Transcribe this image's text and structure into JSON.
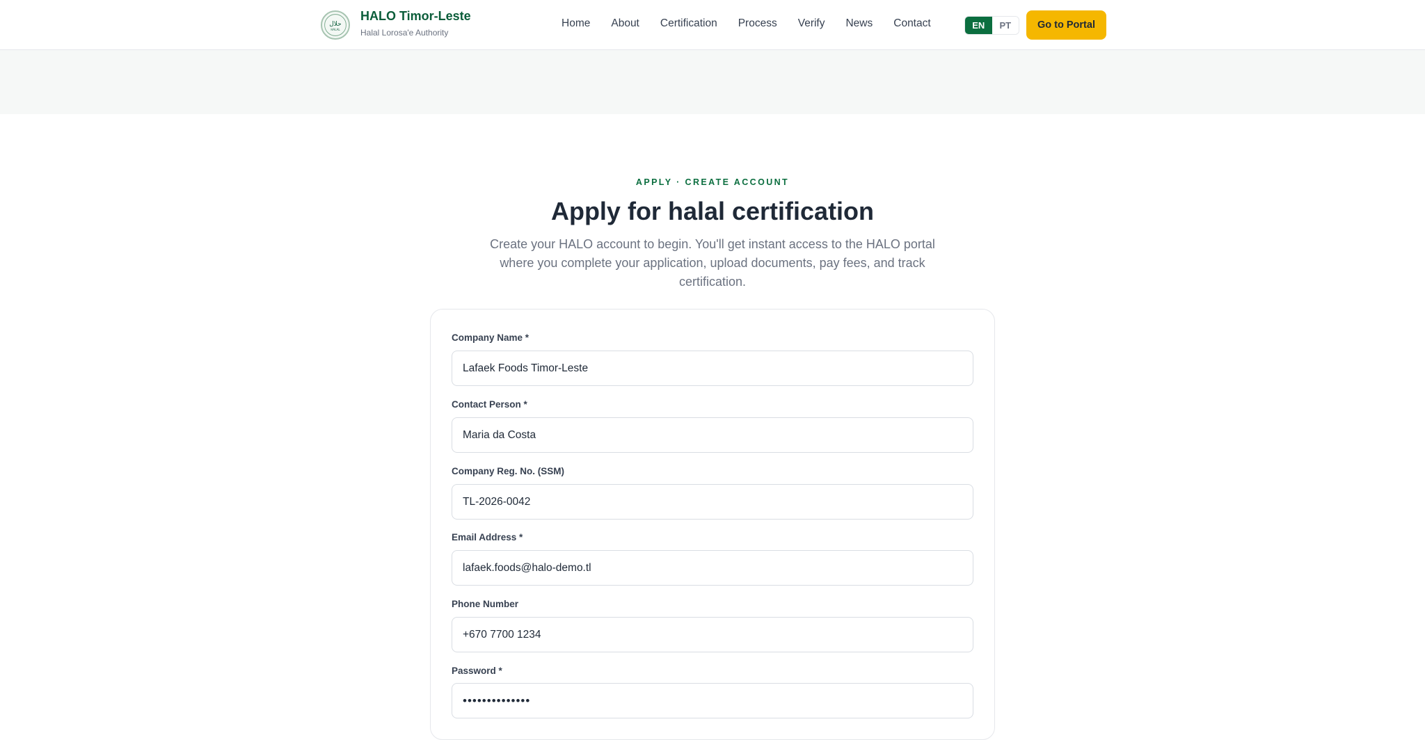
{
  "brand": {
    "title": "HALO Timor-Leste",
    "subtitle": "Halal Lorosa'e Authority",
    "logo_icon": "halal-seal-icon",
    "logo_text": "حلال",
    "logo_sub": "HALAL"
  },
  "nav": {
    "items": [
      {
        "label": "Home"
      },
      {
        "label": "About"
      },
      {
        "label": "Certification"
      },
      {
        "label": "Process"
      },
      {
        "label": "Verify"
      },
      {
        "label": "News"
      },
      {
        "label": "Contact"
      }
    ]
  },
  "lang": {
    "en": "EN",
    "pt": "PT",
    "selected": "EN"
  },
  "header": {
    "portal_button": "Go to Portal"
  },
  "intro": {
    "eyebrow": "APPLY · CREATE ACCOUNT",
    "title": "Apply for halal certification",
    "lead": "Create your HALO account to begin. You'll get instant access to the HALO portal where you complete your application, upload documents, pay fees, and track certification."
  },
  "form": {
    "company_name": {
      "label": "Company Name *",
      "value": "Lafaek Foods Timor-Leste"
    },
    "contact_person": {
      "label": "Contact Person *",
      "value": "Maria da Costa"
    },
    "reg_no": {
      "label": "Company Reg. No. (SSM)",
      "value": "TL-2026-0042"
    },
    "email": {
      "label": "Email Address *",
      "value": "lafaek.foods@halo-demo.tl"
    },
    "phone": {
      "label": "Phone Number",
      "value": "+670 7700 1234"
    },
    "password": {
      "label": "Password *",
      "value": "••••••••••••••"
    }
  },
  "colors": {
    "brand_green": "#0b6e3f",
    "accent_yellow": "#f5b700"
  }
}
